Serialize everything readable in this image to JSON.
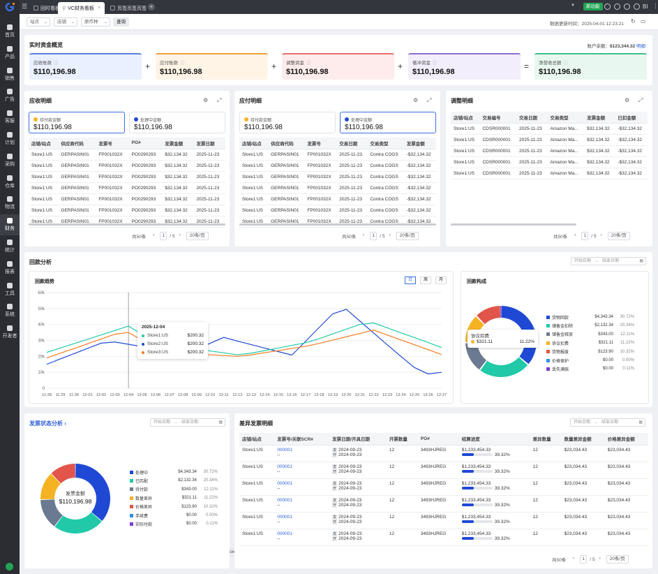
{
  "sidebar": {
    "items": [
      {
        "label": "首页"
      },
      {
        "label": "产品"
      },
      {
        "label": "销售"
      },
      {
        "label": "广告"
      },
      {
        "label": "客服"
      },
      {
        "label": "计划"
      },
      {
        "label": "采购"
      },
      {
        "label": "仓库"
      },
      {
        "label": "物流"
      },
      {
        "label": "财务"
      },
      {
        "label": "统计"
      },
      {
        "label": "报表"
      },
      {
        "label": "工具"
      },
      {
        "label": "系统"
      },
      {
        "label": "开发者"
      }
    ]
  },
  "topbar": {
    "tabs": [
      {
        "label": "回时看板"
      },
      {
        "label": "VC财务看板"
      },
      {
        "label": "页签页签页签"
      }
    ],
    "badge": "新功能",
    "user": "BI",
    "accent": "#1f49d4"
  },
  "filters": {
    "site": "站点",
    "store": "店铺",
    "currency": "原币种",
    "query": "查询",
    "update_label": "数据更新时间：",
    "update_time": "2025-04-01 12:23:21"
  },
  "overview": {
    "title": "实时资金概览",
    "balance_label": "账户余额：",
    "balance": "$123,344.32",
    "balance_link": "明细",
    "boxes": [
      {
        "label": "应收账款",
        "value": "$110,196.98",
        "color": "#5b7fe0",
        "bg": "#eaf0ff"
      },
      {
        "label": "应付账款",
        "value": "$110,196.98",
        "color": "#f0a040",
        "bg": "#fff4e6"
      },
      {
        "label": "调整资金",
        "value": "$110,196.98",
        "color": "#e87070",
        "bg": "#fdeceb"
      },
      {
        "label": "循冲资金",
        "value": "$110,196.98",
        "color": "#8a6fd8",
        "bg": "#f2eefc"
      },
      {
        "label": "净营收总额",
        "value": "$110,196.98",
        "color": "#3cc08a",
        "bg": "#e8f8f1"
      }
    ],
    "ops": [
      "+",
      "+",
      "+",
      "="
    ]
  },
  "receivable": {
    "title": "应收明细",
    "subs": [
      {
        "label": "待付款金额",
        "value": "$110,196.98"
      },
      {
        "label": "处理中金额",
        "value": "$110,196.98"
      }
    ],
    "headers": [
      "店铺/站点",
      "供应商代码",
      "发票号",
      "PO#",
      "发票金额",
      "发票日期"
    ],
    "rows": [
      [
        "Store1:US",
        "GERPASIN01",
        "FP001032X",
        "PO0290293",
        "$32,134.32",
        "2025-11-23"
      ],
      [
        "Store1:US",
        "GERPASIN01",
        "FP001032X",
        "PO0290293",
        "$32,134.32",
        "2025-11-23"
      ],
      [
        "Store1:US",
        "GERPASIN01",
        "FP001032X",
        "PO0290293",
        "$32,134.32",
        "2025-11-23"
      ],
      [
        "Store1:US",
        "GERPASIN01",
        "FP001032X",
        "PO0290293",
        "$32,134.32",
        "2025-11-23"
      ],
      [
        "Store1:US",
        "GERPASIN01",
        "FP001032X",
        "PO0290293",
        "$32,134.32",
        "2025-11-23"
      ],
      [
        "Store1:US",
        "GERPASIN01",
        "FP001032X",
        "PO0290293",
        "$32,134.32",
        "2025-11-23"
      ],
      [
        "Store1:US",
        "GERPASIN01",
        "FP001032X",
        "PO0290293",
        "$32,134.32",
        "2025-11-23"
      ]
    ],
    "total": "共50条",
    "page": "1",
    "pages": "5",
    "size": "20条/页"
  },
  "payable": {
    "title": "应付明细",
    "subs": [
      {
        "label": "待付款金额",
        "value": "$110,196.98"
      },
      {
        "label": "处理中金额",
        "value": "$110,196.98"
      }
    ],
    "headers": [
      "店铺/站点",
      "供应商代码",
      "发票号",
      "交易日期",
      "交易类型",
      "发票金额"
    ],
    "rows": [
      [
        "Store1:US",
        "GERPASIN01",
        "FP001032X",
        "2025-11-23",
        "Contra COGS",
        "-$32,134.32"
      ],
      [
        "Store1:US",
        "GERPASIN01",
        "FP001032X",
        "2025-11-23",
        "Contra COGS",
        "-$32,134.32"
      ],
      [
        "Store1:US",
        "GERPASIN01",
        "FP001032X",
        "2025-11-23",
        "Contra COGS",
        "-$32,134.32"
      ],
      [
        "Store1:US",
        "GERPASIN01",
        "FP001032X",
        "2025-11-23",
        "Contra COGS",
        "-$32,134.32"
      ],
      [
        "Store1:US",
        "GERPASIN01",
        "FP001032X",
        "2025-11-23",
        "Contra COGS",
        "-$32,134.32"
      ],
      [
        "Store1:US",
        "GERPASIN01",
        "FP001032X",
        "2025-11-23",
        "Contra COGS",
        "-$32,134.32"
      ],
      [
        "Store1:US",
        "GERPASIN01",
        "FP001032X",
        "2025-11-23",
        "Contra COGS",
        "-$32,134.32"
      ]
    ],
    "total": "共50条",
    "page": "1",
    "pages": "5",
    "size": "20条/页"
  },
  "adjust": {
    "title": "调整明细",
    "headers": [
      "店铺/站点",
      "交易编号",
      "交易日期",
      "交易类型",
      "发票金额",
      "已扣金额"
    ],
    "rows": [
      [
        "Store1:US",
        "CDSR000001",
        "2025-11-23",
        "Amazon Ma...",
        "$32,134.32",
        "-$32,134.32"
      ],
      [
        "Store1:US",
        "CDSR000001",
        "2025-11-23",
        "Amazon Ma...",
        "$32,134.32",
        "-$32,134.32"
      ],
      [
        "Store1:US",
        "CDSR000001",
        "2025-11-23",
        "Amazon Ma...",
        "$32,134.32",
        "-$32,134.32"
      ],
      [
        "Store1:US",
        "CDSR000001",
        "2025-11-23",
        "Amazon Ma...",
        "$32,134.32",
        "-$32,134.32"
      ],
      [
        "Store1:US",
        "CDSR000001",
        "2025-11-23",
        "Amazon Ma...",
        "$32,134.32",
        "-$32,134.32"
      ]
    ],
    "total": "共50条",
    "page": "1",
    "pages": "5",
    "size": "20条/页"
  },
  "analysis": {
    "title": "回款分析",
    "date_start": "开始日期",
    "date_end": "结束日期",
    "trend_title": "回款趋势",
    "store_selects": [
      {
        "label": "Store1:US",
        "color": "#1f49d4"
      },
      {
        "label": "Store2:US",
        "color": "#21c9a8"
      },
      {
        "label": "Store2:UK",
        "color": "#f57c1f"
      },
      {
        "label": "请选择",
        "color": "#999999"
      }
    ],
    "gran": [
      "日",
      "周",
      "月"
    ],
    "tooltip": {
      "date": "2025-12-04",
      "rows": [
        {
          "name": "Store1:US",
          "value": "$200.32",
          "color": "#21c9a8"
        },
        {
          "name": "Store2:US",
          "value": "$200.32",
          "color": "#1f49d4"
        },
        {
          "name": "Store3:US",
          "value": "$200.32",
          "color": "#f57c1f"
        }
      ]
    },
    "comp_title": "回款构成",
    "comp_tooltip": {
      "name": "协议扣费",
      "value": "$321.11",
      "pct": "11.22%"
    },
    "comp_legend": [
      {
        "name": "货物回款",
        "amount": "$4,343.34",
        "pct": "30.72%",
        "color": "#1f49d4"
      },
      {
        "name": "储备金扣除",
        "amount": "$2,132.34",
        "pct": "20.34%",
        "color": "#21c9a8"
      },
      {
        "name": "储备金释放",
        "amount": "$343.00",
        "pct": "12.11%",
        "color": "#6b7a90"
      },
      {
        "name": "协议扣费",
        "amount": "$321.11",
        "pct": "11.22%",
        "color": "#f5b324"
      },
      {
        "name": "货物报废",
        "amount": "$123.90",
        "pct": "10.32%",
        "color": "#e2554a"
      },
      {
        "name": "价格保护",
        "amount": "$0.00",
        "pct": "0.00%",
        "color": "#2f8ee6"
      },
      {
        "name": "丢失满赔",
        "amount": "$0.00",
        "pct": "0.11%",
        "color": "#7a3ccf"
      }
    ]
  },
  "chart_data": [
    {
      "type": "line",
      "title": "回款趋势",
      "x": [
        "11-28",
        "11-29",
        "11-30",
        "12-01",
        "12-02",
        "12-03",
        "12-04",
        "12-05",
        "12-06",
        "12-07",
        "12-08",
        "12-09",
        "12-10",
        "12-11",
        "12-12",
        "12-13",
        "12-14",
        "12-15",
        "12-16",
        "12-17",
        "12-18",
        "12-19",
        "12-20",
        "12-21",
        "12-22",
        "12-23",
        "12-24",
        "12-25",
        "12-26",
        "12-27"
      ],
      "ylim": [
        0,
        60000
      ],
      "yticks": [
        "0",
        "10k",
        "20k",
        "30k",
        "40k",
        "50k",
        "60k"
      ],
      "series": [
        {
          "name": "Store1:US",
          "color": "#1f49d4",
          "values": [
            15000,
            18400,
            21700,
            25000,
            28300,
            29000,
            27600,
            26100,
            24700,
            23200,
            21800,
            24500,
            28200,
            31900,
            29600,
            27400,
            25200,
            23000,
            20800,
            29400,
            38100,
            46700,
            49500,
            42100,
            34700,
            27300,
            20000,
            13000,
            9000,
            10000
          ]
        },
        {
          "name": "Store2:US",
          "color": "#21c9a8",
          "values": [
            22500,
            25200,
            28000,
            30700,
            33500,
            36200,
            39000,
            33700,
            28300,
            27100,
            25900,
            24700,
            23400,
            22200,
            21000,
            22000,
            23600,
            25200,
            26900,
            28500,
            31100,
            34100,
            37100,
            40000,
            41000,
            37900,
            34800,
            31800,
            28700,
            25500
          ]
        },
        {
          "name": "Store2:UK",
          "color": "#f57c1f",
          "values": [
            19000,
            22000,
            24900,
            27900,
            30900,
            33900,
            35000,
            30100,
            25100,
            23600,
            22000,
            21500,
            21000,
            20500,
            20000,
            20900,
            22300,
            23600,
            25000,
            26300,
            28100,
            30200,
            32300,
            34400,
            36500,
            33400,
            30300,
            27300,
            24200,
            21100
          ]
        }
      ]
    },
    {
      "type": "pie",
      "title": "回款构成",
      "categories": [
        "货物回款",
        "储备金扣除",
        "储备金释放",
        "协议扣费",
        "货物报废",
        "价格保护",
        "丢失满赔"
      ],
      "values": [
        30.72,
        20.34,
        12.11,
        11.22,
        10.32,
        0.0,
        0.11
      ]
    },
    {
      "type": "pie",
      "title": "",
      "center_label": "发票金额",
      "center_value": "$110,196.98",
      "categories": [
        "处理中",
        "已匹配",
        "待付款",
        "数量差异",
        "价格差异",
        "手续费",
        "实际付款"
      ],
      "values": [
        30.72,
        20.34,
        12.11,
        11.22,
        10.32,
        0.0,
        0.11
      ]
    }
  ],
  "invoice_status": {
    "title": "发票状态分析",
    "date_start": "开始日期",
    "date_end": "结束日期",
    "center_label": "发票金额",
    "center_value": "$110,196.98",
    "legend": [
      {
        "name": "处理中",
        "amount": "$4,343.34",
        "pct": "30.72%",
        "color": "#1f49d4"
      },
      {
        "name": "已匹配",
        "amount": "$2,132.34",
        "pct": "20.34%",
        "color": "#21c9a8"
      },
      {
        "name": "待付款",
        "amount": "$343.00",
        "pct": "12.11%",
        "color": "#6b7a90"
      },
      {
        "name": "数量差异",
        "amount": "$321.11",
        "pct": "11.22%",
        "color": "#f5b324"
      },
      {
        "name": "价格差异",
        "amount": "$123.90",
        "pct": "10.32%",
        "color": "#e2554a"
      },
      {
        "name": "手续费",
        "amount": "$0.00",
        "pct": "0.00%",
        "color": "#2f8ee6"
      },
      {
        "name": "实际付款",
        "amount": "$0.00",
        "pct": "0.11%",
        "color": "#7a3ccf"
      }
    ]
  },
  "diff": {
    "title": "差异发票明细",
    "date_start": "开始日期",
    "date_end": "结束日期",
    "headers": [
      "店铺/站点",
      "发票号/关联SCR#",
      "发票日期/开具日期",
      "开票数量",
      "PO#",
      "结算进度",
      "差异数量",
      "数量差异金额",
      "价格差异金额"
    ],
    "tag1": "发",
    "tag2": "开",
    "rows": [
      {
        "store": "Store1:US",
        "inv": "000001",
        "sub": "--",
        "d1": "2024-09-23",
        "d2": "2024-09-23",
        "qty": "12",
        "po": "3493HJREG",
        "amt": "$1,233,454.33",
        "pct": "39.32%",
        "progress": 0.3932,
        "dq": "12",
        "qd": "$23,034.43",
        "pd": "$23,034.43"
      },
      {
        "store": "Store1:US",
        "inv": "000001",
        "sub": "--",
        "d1": "2024-09-23",
        "d2": "2024-09-23",
        "qty": "12",
        "po": "3493HJREG",
        "amt": "$1,233,454.33",
        "pct": "39.32%",
        "progress": 0.3932,
        "dq": "12",
        "qd": "$23,034.43",
        "pd": "$23,034.43"
      },
      {
        "store": "Store1:US",
        "inv": "000001",
        "sub": "--",
        "d1": "2024-09-23",
        "d2": "2024-09-23",
        "qty": "12",
        "po": "3493HJREG",
        "amt": "$1,233,454.33",
        "pct": "39.32%",
        "progress": 0.3932,
        "dq": "12",
        "qd": "$23,034.43",
        "pd": "$23,034.43"
      },
      {
        "store": "Store1:US",
        "inv": "000001",
        "sub": "--",
        "d1": "2024-09-23",
        "d2": "2024-09-23",
        "qty": "12",
        "po": "3493HJREG",
        "amt": "$1,233,454.33",
        "pct": "39.32%",
        "progress": 0.3932,
        "dq": "12",
        "qd": "$23,034.43",
        "pd": "$23,034.43"
      },
      {
        "store": "Store1:US",
        "inv": "000001",
        "sub": "--",
        "d1": "2024-09-23",
        "d2": "2024-09-23",
        "qty": "12",
        "po": "3493HJREG",
        "amt": "$1,233,454.33",
        "pct": "39.32%",
        "progress": 0.3932,
        "dq": "12",
        "qd": "$23,034.43",
        "pd": "$23,034.43"
      },
      {
        "store": "Store1:US",
        "inv": "000001",
        "sub": "--",
        "d1": "2024-09-23",
        "d2": "2024-09-23",
        "qty": "12",
        "po": "3493HJREG",
        "amt": "$1,233,454.33",
        "pct": "39.32%",
        "progress": 0.3932,
        "dq": "12",
        "qd": "$23,034.43",
        "pd": "$23,034.43"
      }
    ],
    "total": "共50条",
    "page": "1",
    "pages": "5",
    "size": "20条/页"
  }
}
